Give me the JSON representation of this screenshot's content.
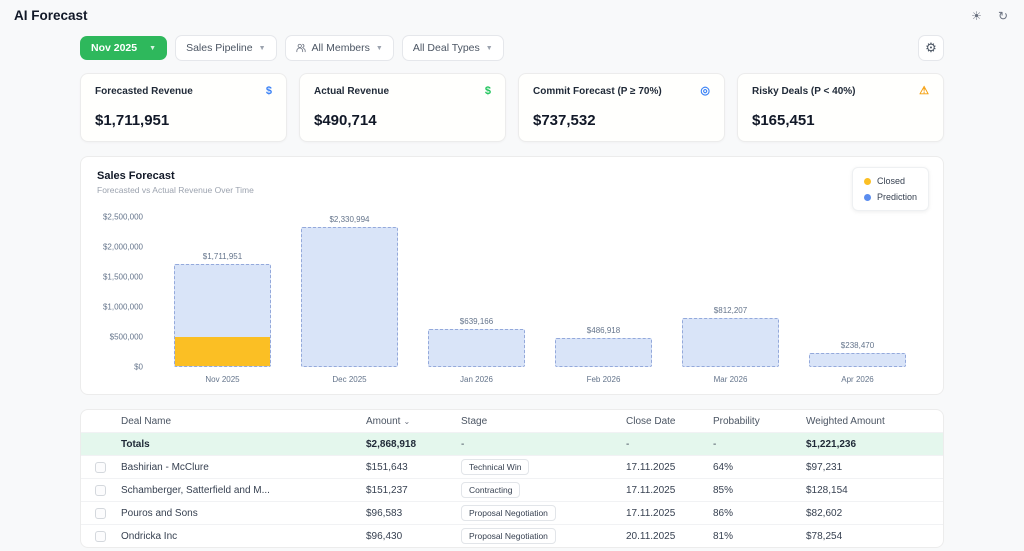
{
  "page": {
    "title": "AI Forecast"
  },
  "filters": {
    "period": "Nov 2025",
    "pipeline": "Sales Pipeline",
    "members": "All Members",
    "deal_types": "All Deal Types"
  },
  "kpis": [
    {
      "label": "Forecasted Revenue",
      "value": "$1,711,951",
      "icon": "dollar",
      "icon_color": "#3b82f6"
    },
    {
      "label": "Actual Revenue",
      "value": "$490,714",
      "icon": "dollar",
      "icon_color": "#22c55e"
    },
    {
      "label": "Commit Forecast (P ≥ 70%)",
      "value": "$737,532",
      "icon": "target",
      "icon_color": "#3b82f6"
    },
    {
      "label": "Risky Deals (P < 40%)",
      "value": "$165,451",
      "icon": "warning",
      "icon_color": "#f59e0b"
    }
  ],
  "chart": {
    "title": "Sales Forecast",
    "subtitle": "Forecasted vs Actual Revenue Over Time",
    "legend": [
      {
        "label": "Closed",
        "color": "#fbbf24"
      },
      {
        "label": "Prediction",
        "color": "#5b8def"
      }
    ]
  },
  "chart_data": {
    "type": "bar",
    "categories": [
      "Nov 2025",
      "Dec 2025",
      "Jan 2026",
      "Feb 2026",
      "Mar 2026",
      "Apr 2026"
    ],
    "series": [
      {
        "name": "Closed",
        "values": [
          490714,
          0,
          0,
          0,
          0,
          0
        ]
      },
      {
        "name": "Prediction",
        "values": [
          1221237,
          2330994,
          639166,
          486918,
          812207,
          238470
        ]
      }
    ],
    "bar_totals": [
      1711951,
      2330994,
      639166,
      486918,
      812207,
      238470
    ],
    "bar_labels": [
      "$1,711,951",
      "$2,330,994",
      "$639,166",
      "$486,918",
      "$812,207",
      "$238,470"
    ],
    "y_ticks": [
      "$0",
      "$500,000",
      "$1,000,000",
      "$1,500,000",
      "$2,000,000",
      "$2,500,000"
    ],
    "ylim": [
      0,
      2500000
    ],
    "grid": false,
    "legend_position": "top-right"
  },
  "table": {
    "columns": [
      "Deal Name",
      "Amount",
      "Stage",
      "Close Date",
      "Probability",
      "Weighted Amount"
    ],
    "sorted_column": "Amount",
    "totals_row": {
      "name": "Totals",
      "amount": "$2,868,918",
      "stage": "-",
      "close_date": "-",
      "probability": "-",
      "weighted": "$1,221,236"
    },
    "rows": [
      {
        "name": "Bashirian - McClure",
        "amount": "$151,643",
        "stage": "Technical Win",
        "close_date": "17.11.2025",
        "probability": "64%",
        "weighted": "$97,231"
      },
      {
        "name": "Schamberger, Satterfield and M...",
        "amount": "$151,237",
        "stage": "Contracting",
        "close_date": "17.11.2025",
        "probability": "85%",
        "weighted": "$128,154"
      },
      {
        "name": "Pouros and Sons",
        "amount": "$96,583",
        "stage": "Proposal Negotiation",
        "close_date": "17.11.2025",
        "probability": "86%",
        "weighted": "$82,602"
      },
      {
        "name": "Ondricka Inc",
        "amount": "$96,430",
        "stage": "Proposal Negotiation",
        "close_date": "20.11.2025",
        "probability": "81%",
        "weighted": "$78,254"
      }
    ]
  },
  "colors": {
    "accent_green": "#2eb85c",
    "bar_fill": "#d9e4f8",
    "bar_border": "#94a9db",
    "closed_fill": "#fbbf24",
    "totals_row_bg": "#e4f7ed",
    "page_bg": "#f8f9fa"
  }
}
